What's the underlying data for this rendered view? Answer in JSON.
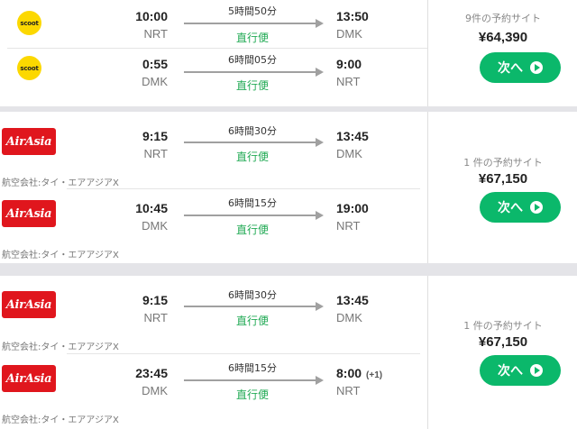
{
  "itineraries": [
    {
      "legs": [
        {
          "airline_logo": "scoot",
          "logo_text": "scoot",
          "dep_time": "10:00",
          "dep_code": "NRT",
          "duration": "5時間50分",
          "arr_time": "13:50",
          "arr_code": "DMK",
          "stops": "直行便",
          "operator": "",
          "day_offset": ""
        },
        {
          "airline_logo": "scoot",
          "logo_text": "scoot",
          "dep_time": "0:55",
          "dep_code": "DMK",
          "duration": "6時間05分",
          "arr_time": "9:00",
          "arr_code": "NRT",
          "stops": "直行便",
          "operator": "",
          "day_offset": ""
        }
      ],
      "sites": "9件の予約サイト",
      "price": "¥64,390",
      "button": "次へ"
    },
    {
      "legs": [
        {
          "airline_logo": "airasia",
          "logo_text": "AirAsia",
          "dep_time": "9:15",
          "dep_code": "NRT",
          "duration": "6時間30分",
          "arr_time": "13:45",
          "arr_code": "DMK",
          "stops": "直行便",
          "operator": "航空会社:タイ・エアアジアX",
          "day_offset": ""
        },
        {
          "airline_logo": "airasia",
          "logo_text": "AirAsia",
          "dep_time": "10:45",
          "dep_code": "DMK",
          "duration": "6時間15分",
          "arr_time": "19:00",
          "arr_code": "NRT",
          "stops": "直行便",
          "operator": "航空会社:タイ・エアアジアX",
          "day_offset": ""
        }
      ],
      "sites": "1 件の予約サイト",
      "price": "¥67,150",
      "button": "次へ"
    },
    {
      "legs": [
        {
          "airline_logo": "airasia",
          "logo_text": "AirAsia",
          "dep_time": "9:15",
          "dep_code": "NRT",
          "duration": "6時間30分",
          "arr_time": "13:45",
          "arr_code": "DMK",
          "stops": "直行便",
          "operator": "航空会社:タイ・エアアジアX",
          "day_offset": ""
        },
        {
          "airline_logo": "airasia",
          "logo_text": "AirAsia",
          "dep_time": "23:45",
          "dep_code": "DMK",
          "duration": "6時間15分",
          "arr_time": "8:00",
          "arr_code": "NRT",
          "stops": "直行便",
          "operator": "航空会社:タイ・エアアジアX",
          "day_offset": "(+1)"
        }
      ],
      "sites": "1 件の予約サイト",
      "price": "¥67,150",
      "button": "次へ"
    }
  ],
  "colors": {
    "accent_green": "#0bb86b",
    "nonstop_green": "#22aa55",
    "scoot_yellow": "#fcd800",
    "airasia_red": "#e0161d"
  }
}
